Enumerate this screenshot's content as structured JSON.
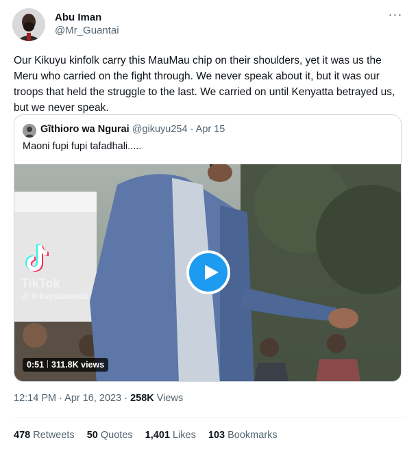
{
  "author": {
    "name": "Abu Iman",
    "handle": "@Mr_Guantai"
  },
  "more_label": "···",
  "tweet_text": "Our Kikuyu kinfolk carry this MauMau chip on their shoulders, yet it was us the Meru who carried on the fight through. We never speak about it, but it was our troops that held the struggle to the last. We carried on until Kenyatta betrayed us, but we never speak.",
  "quoted": {
    "name": "Gĩthioro wa Ngurai",
    "handle": "@gikuyu254",
    "date": "· Apr 15",
    "text": "Maoni fupi fupi tafadhali.....",
    "video": {
      "watermark_brand": "TikTok",
      "watermark_user": "@ kikuyuawards",
      "duration": "0:51",
      "views": "311.8K views"
    }
  },
  "meta": {
    "time": "12:14 PM · Apr 16, 2023 ·",
    "views_count": "258K",
    "views_label": "Views"
  },
  "stats": [
    {
      "count": "478",
      "label": "Retweets"
    },
    {
      "count": "50",
      "label": "Quotes"
    },
    {
      "count": "1,401",
      "label": "Likes"
    },
    {
      "count": "103",
      "label": "Bookmarks"
    }
  ],
  "colors": {
    "accent": "#1d9bf0",
    "text_primary": "#0f1419",
    "text_secondary": "#536471",
    "border": "#cfd9de"
  }
}
